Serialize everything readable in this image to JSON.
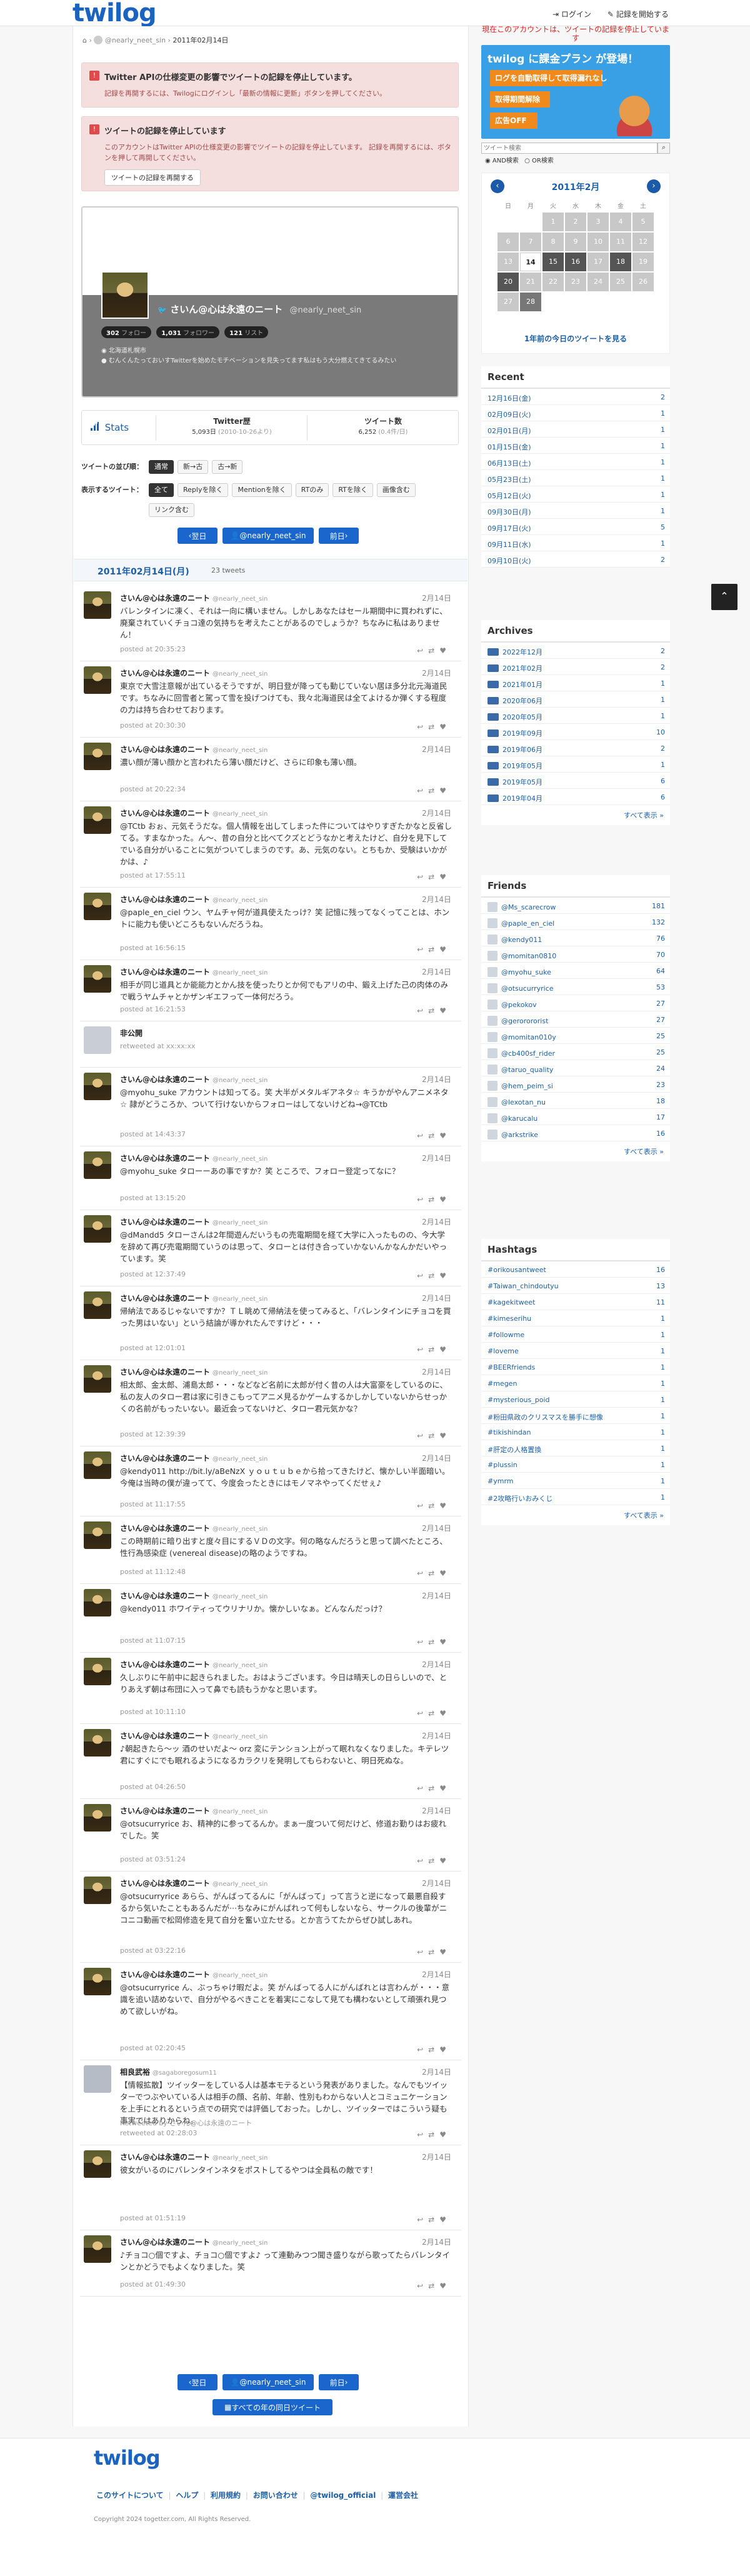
{
  "header": {
    "logo": "twilog",
    "login": "ログイン",
    "record": "記録を開始する",
    "warning": "現在このアカウントは、ツイートの記録を停止しています"
  },
  "breadcrumb": [
    "@nearly_neet_sin",
    "2011年02月14日"
  ],
  "alerts": [
    {
      "title": "Twitter APIの仕様変更の影響でツイートの記録を停止しています。",
      "body": "記録を再開するには、Twilogにログインし「最新の情報に更新」ボタンを押してください。"
    },
    {
      "title": "ツイートの記録を停止しています",
      "body": "このアカウントはTwitter APIの仕様変更の影響でツイートの記録を停止しています。 記録を再開するには、ボタンを押して再開してください。",
      "button": "ツイートの記録を再開する"
    }
  ],
  "profile": {
    "name": "さいん@心は永遠のニート",
    "handle": "@nearly_neet_sin",
    "following": "302",
    "following_label": "フォロー",
    "followers": "1,031",
    "followers_label": "フォロワー",
    "lists": "121",
    "lists_label": "リスト",
    "location": "北海道札幌市",
    "bio": "むんくんたっておいすTwitterを始めたモチベーションを見失ってます私はもう大分燃えてきてるみたい"
  },
  "stats": {
    "label": "Stats",
    "twitter_label": "Twitter歴",
    "twitter_value": "5,093日",
    "twitter_sub": "(2010-10-26より)",
    "count_label": "ツイート数",
    "count_value": "6,252",
    "count_sub": "(0.4件/日)"
  },
  "filters": {
    "order_label": "ツイートの並び順：",
    "order": [
      "通常",
      "新→古",
      "古→新"
    ],
    "show_label": "表示するツイート：",
    "show": [
      "全て",
      "Replyを除く",
      "Mentionを除く",
      "RTのみ",
      "RTを除く",
      "画像含む",
      "リンク含む"
    ]
  },
  "nav": {
    "prev": "翌日",
    "user": "@nearly_neet_sin",
    "next": "前日",
    "all_today": "すべての年の同日ツイート"
  },
  "day": {
    "title": "2011年02月14日(月)",
    "count": "23 tweets"
  },
  "tweets": [
    {
      "name": "さいん@心は永遠のニート",
      "handle": "@nearly_neet_sin",
      "date": "2月14日",
      "text": "バレンタインに凍く、それは一向に構いません。しかしあなたはセール期間中に買われずに、廃棄されていくチョコ達の気持ちを考えたことがあるのでしょうか？ちなみに私はありません！",
      "posted": "posted at 20:35:23"
    },
    {
      "name": "さいん@心は永遠のニート",
      "handle": "@nearly_neet_sin",
      "date": "2月14日",
      "text": "東京で大雪注意報が出ているそうですが、明日登が降っても動じていない居ほ多分北元海道民です。ちなみに回雪者と駕って雪を投げつけても、我々北海道民は全てよけるか弾くする程度の力は持ち合わせております。",
      "posted": "posted at 20:30:30"
    },
    {
      "name": "さいん@心は永遠のニート",
      "handle": "@nearly_neet_sin",
      "date": "2月14日",
      "text": "濃い顔が薄い顔かと言われたら薄い顔だけど、さらに印象も薄い顔。",
      "posted": "posted at 20:22:34"
    },
    {
      "name": "さいん@心は永遠のニート",
      "handle": "@nearly_neet_sin",
      "date": "2月14日",
      "text": "@TCtb おぉ、元気そうだな。個人情報を出してしまった件についてはやりすぎたかなと反省してる。すまなかった。ん〜、昔の自分と比べてクズとどうなかと考えたけど、自分を見下してでいる自分がいることに気がついてしまうのです。あ、元気のない。とちもか、受験はいかがかは、♪",
      "posted": "posted at 17:55:11"
    },
    {
      "name": "さいん@心は永遠のニート",
      "handle": "@nearly_neet_sin",
      "date": "2月14日",
      "text": "@paple_en_ciel ウン、ヤムチャ何が道具使えたっけ？笑 記憶に残ってなくってことは、ホントに能力も使いどころもないんだろうね。",
      "posted": "posted at 16:56:15"
    },
    {
      "name": "さいん@心は永遠のニート",
      "handle": "@nearly_neet_sin",
      "date": "2月14日",
      "text": "相手が同じ道具とか能能力とかん技を使ったりとか何でもアリの中、鍛え上げた己の肉体のみで戦うヤムチャとかザンギエフって一体何だろう。",
      "posted": "posted at 16:21:53"
    },
    {
      "name": "非公開",
      "handle": "",
      "date": "",
      "text": "retweeted at xx:xx:xx",
      "posted": "",
      "rt": true
    },
    {
      "name": "さいん@心は永遠のニート",
      "handle": "@nearly_neet_sin",
      "date": "2月14日",
      "text": "@myohu_suke アカウントは知ってる。笑 大半がメタルギアネタ☆ キうかがやんアニメネタ☆ 隷がどうころか、ついて行けないからフォローはしてないけどね→@TCtb",
      "posted": "posted at 14:43:37"
    },
    {
      "name": "さいん@心は永遠のニート",
      "handle": "@nearly_neet_sin",
      "date": "2月14日",
      "text": "@myohu_suke タローーあの事ですか？笑 ところで、フォロー登定ってなに？",
      "posted": "posted at 13:15:20"
    },
    {
      "name": "さいん@心は永遠のニート",
      "handle": "@nearly_neet_sin",
      "date": "2月14日",
      "text": "@dMandd5 タローさんは2年間遊んだいうもの売電期間を経て大学に入ったものの、今大学を辞めて再び売電期間ていうのは思って、タローとは付き合っていかないんかなんかだいやっています。笑",
      "posted": "posted at 12:37:49"
    },
    {
      "name": "さいん@心は永遠のニート",
      "handle": "@nearly_neet_sin",
      "date": "2月14日",
      "text": "帰納法であるじゃないですか？ＴＬ眺めて帰納法を使ってみると、「バレンタインにチョコを買った男はいない」という結論が導かれたんですけど・・・",
      "posted": "posted at 12:01:01"
    },
    {
      "name": "さいん@心は永遠のニート",
      "handle": "@nearly_neet_sin",
      "date": "2月14日",
      "text": "相太郎、金太郎、浦島太郎・・・などなど名前に太郎が付く昔の人は大富豪をしているのに、私の友人のタロー君は家に引きこもってアニメ見るかゲームするかしかしていないからせっかくの名前がもったいない。最近会ってないけど、タロー君元気かな？",
      "posted": "posted at 12:39:39"
    },
    {
      "name": "さいん@心は永遠のニート",
      "handle": "@nearly_neet_sin",
      "date": "2月14日",
      "text": "@kendy011 http://bit.ly/aBeNzX ｙｏｕｔｕｂｅから拾ってきたけど、懐かしい半面暗い。今俺は当時の僕が違ってて、今度会ったときにはモノマネやってくだせぇ♪",
      "posted": "posted at 11:17:55"
    },
    {
      "name": "さいん@心は永遠のニート",
      "handle": "@nearly_neet_sin",
      "date": "2月14日",
      "text": "この時期前に暗り出すと度々目にするＶＤの文字。何の略なんだろうと思って調べたところ、性行為感染症 (venereal disease)の略のようですね。",
      "posted": "posted at 11:12:48"
    },
    {
      "name": "さいん@心は永遠のニート",
      "handle": "@nearly_neet_sin",
      "date": "2月14日",
      "text": "@kendy011 ホワイティってウリナリか。懐かしいなぁ。どんなんだっけ？",
      "posted": "posted at 11:07:15"
    },
    {
      "name": "さいん@心は永遠のニート",
      "handle": "@nearly_neet_sin",
      "date": "2月14日",
      "text": "久しぶりに午前中に起きられました。おはようございます。今日は晴天しの日らしいので、とりあえず朝は布団に入って鼻でも読もうかなと思います。",
      "posted": "posted at 10:11:10"
    },
    {
      "name": "さいん@心は永遠のニート",
      "handle": "@nearly_neet_sin",
      "date": "2月14日",
      "text": "♪朝起きたら〜ッ 酒のせいだよ〜 orz 変にテンション上がって眠れなくなりました。キテレツ君にすぐにでも眠れるようになるカラクリを発明してもらわないと、明日死ぬな。",
      "posted": "posted at 04:26:50"
    },
    {
      "name": "さいん@心は永遠のニート",
      "handle": "@nearly_neet_sin",
      "date": "2月14日",
      "text": "@otsucurryrice お、精神的に参ってるんか。まぁ一度ついて何だけど、修道お勤りはお疲れでした。笑",
      "posted": "posted at 03:51:24"
    },
    {
      "name": "さいん@心は永遠のニート",
      "handle": "@nearly_neet_sin",
      "date": "2月14日",
      "text": "@otsucurryrice あらら、がんばってるんに「がんばって」って言うと逆になって最悪自殺するから気いたこともあるんだが···ちなみにがんばれって何もしないなら、サークルの後輩がニコニコ動画で松岡修造を見て自分を奮い立たせる。とか言うてたからぜひ試しあれ。",
      "posted": "posted at 03:22:16"
    },
    {
      "name": "さいん@心は永遠のニート",
      "handle": "@nearly_neet_sin",
      "date": "2月14日",
      "text": "@otsucurryrice ん、ぶっちゃけ暇だよ。笑 がんばってる人にがんばれとは言わんが・・・意識を追い詰めないで、自分がやるべきことを着実にこなして見ても構わないとして頑張れ見つめて欲しいがね。",
      "posted": "posted at 02:20:45"
    },
    {
      "name": "相良武裕",
      "handle": "@sagaboregosum11",
      "date": "2月14日",
      "text": "【情報拡散】ツイッターをしている人は基本モテるという発表がありました。なんでもツイッターでつぶやいている人は相手の顔、名前、年齢、性別もわからない人とコミュニケーションを上手にとれるという点での研究では評価しておった。しかし、ツイッターではこういう疑も事実ではありからね。",
      "posted": "Retweeted by さいん@心は永遠のニート",
      "rt": true,
      "rt_line": "retweeted at 02:28:03"
    },
    {
      "name": "さいん@心は永遠のニート",
      "handle": "@nearly_neet_sin",
      "date": "2月14日",
      "text": "彼女がいるのにバレンタインネタをポストしてるやつは全員私の敵です！",
      "posted": "posted at 01:51:19"
    },
    {
      "name": "さいん@心は永遠のニート",
      "handle": "@nearly_neet_sin",
      "date": "2月14日",
      "text": "♪チョコ○個ですよ、チョコ○個ですよ♪ って連動みつつ聞き盛りながら歌ってたらバレンタインとかどうでもよくなりました。笑",
      "posted": "posted at 01:49:30"
    }
  ],
  "sidebar": {
    "ad_title": "twilog に課金プラン が登場！",
    "ad_items": [
      "ログを自動取得して取得漏れなし",
      "取得期間解除",
      "広告OFF"
    ],
    "search_placeholder": "ツイート検索",
    "search_and": "AND検索",
    "search_or": "OR検索",
    "cal_title": "2011年2月",
    "cal_week": [
      "日",
      "月",
      "火",
      "水",
      "木",
      "金",
      "土"
    ],
    "cal_days": [
      [
        "",
        "",
        "1",
        "2",
        "3",
        "4",
        "5"
      ],
      [
        "6",
        "7",
        "8",
        "9",
        "10",
        "11",
        "12"
      ],
      [
        "13",
        "14",
        "15",
        "16",
        "17",
        "18",
        "19"
      ],
      [
        "20",
        "21",
        "22",
        "23",
        "24",
        "25",
        "26"
      ],
      [
        "27",
        "28",
        "",
        "",
        "",
        "",
        ""
      ]
    ],
    "cal_link": "1年前の今日のツイートを見る",
    "recent_title": "Recent",
    "recent": [
      [
        "12月16日(金)",
        "2"
      ],
      [
        "02月09日(火)",
        "1"
      ],
      [
        "02月01日(月)",
        "1"
      ],
      [
        "01月15日(金)",
        "1"
      ],
      [
        "06月13日(土)",
        "1"
      ],
      [
        "05月23日(土)",
        "1"
      ],
      [
        "05月12日(火)",
        "1"
      ],
      [
        "09月30日(月)",
        "1"
      ],
      [
        "09月17日(火)",
        "5"
      ],
      [
        "09月11日(水)",
        "1"
      ],
      [
        "09月10日(火)",
        "2"
      ]
    ],
    "archives_title": "Archives",
    "archives": [
      [
        "2022年12月",
        "2"
      ],
      [
        "2021年02月",
        "2"
      ],
      [
        "2021年01月",
        "1"
      ],
      [
        "2020年06月",
        "1"
      ],
      [
        "2020年05月",
        "1"
      ],
      [
        "2019年09月",
        "10"
      ],
      [
        "2019年06月",
        "2"
      ],
      [
        "2019年05月",
        "1"
      ],
      [
        "2019年05月",
        "6"
      ],
      [
        "2019年04月",
        "6"
      ]
    ],
    "more": "すべて表示 »",
    "friends_title": "Friends",
    "friends": [
      [
        "@Ms_scarecrow",
        "181"
      ],
      [
        "@paple_en_ciel",
        "132"
      ],
      [
        "@kendy011",
        "76"
      ],
      [
        "@momitan0810",
        "70"
      ],
      [
        "@myohu_suke",
        "64"
      ],
      [
        "@otsucurryrice",
        "53"
      ],
      [
        "@pekokov",
        "27"
      ],
      [
        "@gerorororist",
        "27"
      ],
      [
        "@momitan010y",
        "25"
      ],
      [
        "@cb400sf_rider",
        "25"
      ],
      [
        "@taruo_quality",
        "24"
      ],
      [
        "@hem_peim_si",
        "23"
      ],
      [
        "@lexotan_nu",
        "18"
      ],
      [
        "@karucalu",
        "17"
      ],
      [
        "@arkstrike",
        "16"
      ]
    ],
    "hashtags_title": "Hashtags",
    "hashtags": [
      [
        "#orikousantweet",
        "16"
      ],
      [
        "#Taiwan_chindoutyu",
        "13"
      ],
      [
        "#kagekitweet",
        "11"
      ],
      [
        "#kimeserihu",
        "1"
      ],
      [
        "#followme",
        "1"
      ],
      [
        "#loveme",
        "1"
      ],
      [
        "#BEERfriends",
        "1"
      ],
      [
        "#megen",
        "1"
      ],
      [
        "#mysterious_poid",
        "1"
      ],
      [
        "#粉田県政のクリスマスを勝手に想像",
        "1"
      ],
      [
        "#tikishindan",
        "1"
      ],
      [
        "#肝定の人格置換",
        "1"
      ],
      [
        "#plussin",
        "1"
      ],
      [
        "#ymrm",
        "1"
      ],
      [
        "#2攻略行いおみくじ",
        "1"
      ]
    ]
  },
  "footer": {
    "logo": "twilog",
    "links": [
      "このサイトについて",
      "ヘルプ",
      "利用規約",
      "お問い合わせ",
      "@twilog_official",
      "運営会社"
    ],
    "copyright": "Copyright 2024 togetter.com, All Rights Reserved."
  }
}
